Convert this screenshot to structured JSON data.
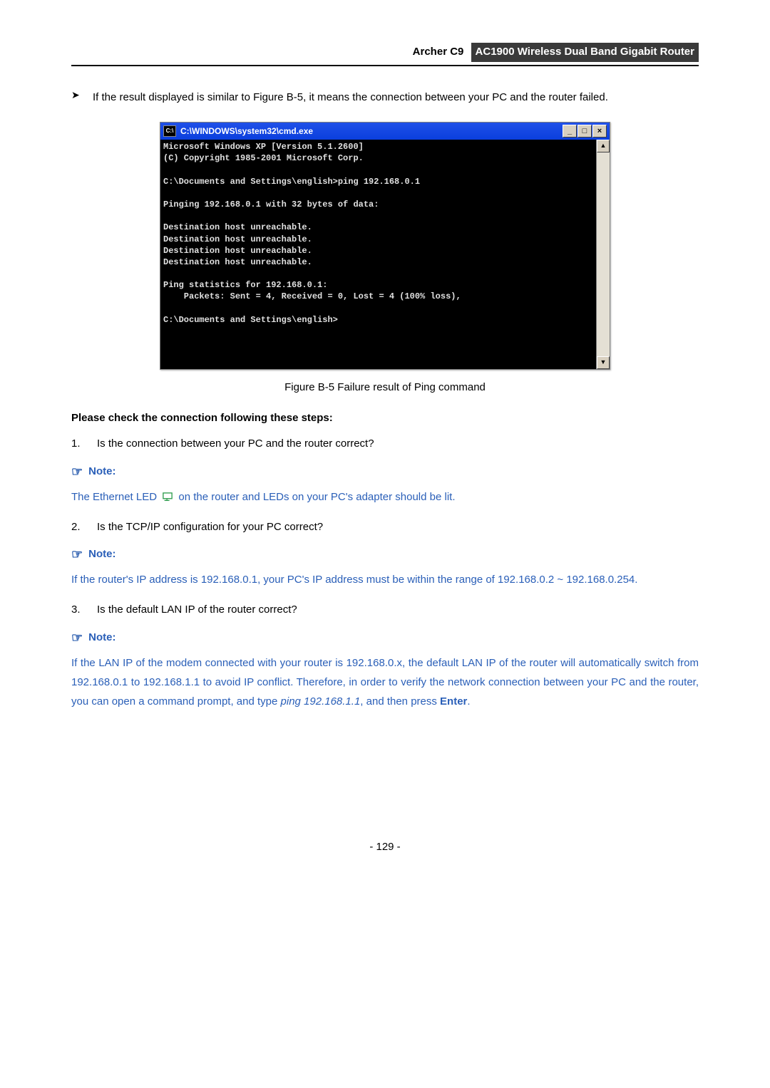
{
  "header": {
    "model": "Archer C9",
    "title": "AC1900 Wireless Dual Band Gigabit Router"
  },
  "intro": {
    "text": "If the result displayed is similar to Figure B-5, it means the connection between your PC and the router failed."
  },
  "cmd": {
    "icon_label": "C:\\",
    "title": "C:\\WINDOWS\\system32\\cmd.exe",
    "btn_min": "_",
    "btn_max": "□",
    "btn_close": "×",
    "scroll_up": "▲",
    "scroll_down": "▼",
    "lines": "Microsoft Windows XP [Version 5.1.2600]\n(C) Copyright 1985-2001 Microsoft Corp.\n\nC:\\Documents and Settings\\english>ping 192.168.0.1\n\nPinging 192.168.0.1 with 32 bytes of data:\n\nDestination host unreachable.\nDestination host unreachable.\nDestination host unreachable.\nDestination host unreachable.\n\nPing statistics for 192.168.0.1:\n    Packets: Sent = 4, Received = 0, Lost = 4 (100% loss),\n\nC:\\Documents and Settings\\english>"
  },
  "figure_caption": "Figure B-5 Failure result of Ping command",
  "check_heading": "Please check the connection following these steps:",
  "steps": {
    "s1_num": "1.",
    "s1_text": "Is the connection between your PC and the router correct?",
    "s2_num": "2.",
    "s2_text": "Is the TCP/IP configuration for your PC correct?",
    "s3_num": "3.",
    "s3_text": "Is the default LAN IP of the router correct?"
  },
  "notes": {
    "label": "Note:",
    "hand": "☞",
    "n1a": "The Ethernet LED ",
    "n1b": " on the router and LEDs on your PC's adapter should be lit.",
    "n2": "If the router's IP address is 192.168.0.1, your PC's IP address must be within the range of 192.168.0.2 ~ 192.168.0.254.",
    "n3a": "If the LAN IP of the modem connected with your router is 192.168.0.x, the default LAN IP of the router will automatically switch from 192.168.0.1 to 192.168.1.1 to avoid IP conflict. Therefore, in order to verify the network connection between your PC and the router, you can open a command prompt, and type ",
    "n3_cmd": "ping 192.168.1.1",
    "n3b": ", and then press ",
    "n3_enter": "Enter",
    "n3c": "."
  },
  "page_number": "- 129 -"
}
